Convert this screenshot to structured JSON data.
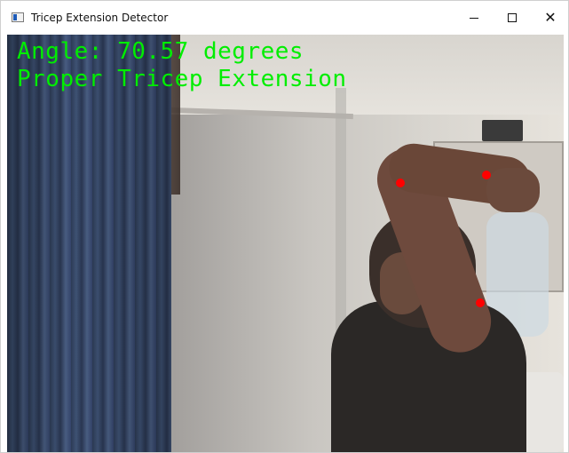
{
  "window": {
    "title": "Tricep Extension Detector",
    "icon": "app-window-icon",
    "controls": {
      "minimize": "minimize-icon",
      "maximize": "maximize-icon",
      "close": "close-icon",
      "close_glyph": "✕"
    }
  },
  "overlay": {
    "angle_text": "Angle: 70.57 degrees",
    "status_text": "Proper Tricep Extension",
    "text_color": "#00ee00"
  },
  "keypoints": {
    "color": "#ff0000",
    "count": 3
  }
}
